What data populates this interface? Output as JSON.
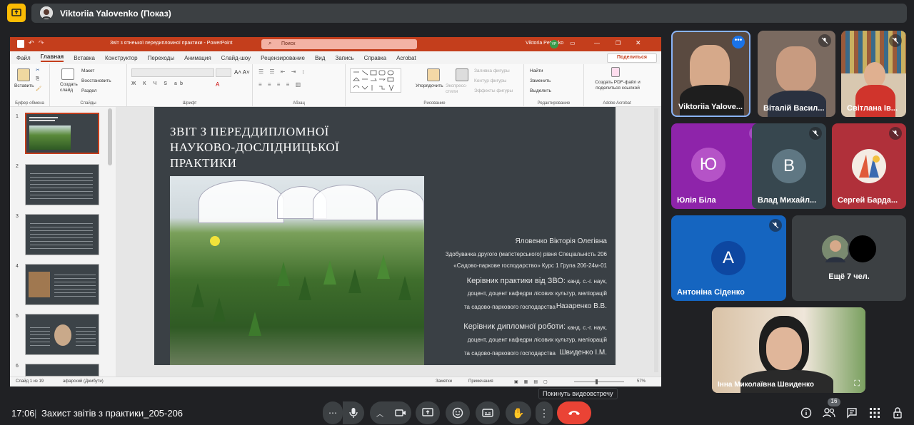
{
  "presenter": {
    "name": "Viktoriia Yalovenko (Показ)"
  },
  "ppt": {
    "window_title": "Звіт з ятнеької передипломної практики  -  PowerPoint",
    "search_placeholder": "Поиск",
    "user": "Viktoria Petrenko",
    "user_initials": "VP",
    "menu": [
      "Файл",
      "Главная",
      "Вставка",
      "Конструктор",
      "Переходы",
      "Анимация",
      "Слайд-шоу",
      "Рецензирование",
      "Вид",
      "Запись",
      "Справка",
      "Acrobat"
    ],
    "share": "Поделиться",
    "ribbon": {
      "insert": "Вставить",
      "clipboard": "Буфер обмена",
      "create_slide": "Создать слайд",
      "layout": "Макет",
      "reset": "Восстановить",
      "section": "Раздел",
      "slides": "Слайды",
      "font": "Шрифт",
      "paragraph": "Абзац",
      "arrange": "Упорядочить",
      "express_styles": "Экспресс-стили",
      "shape_fill": "Заливка фигуры",
      "shape_outline": "Контур фигуры",
      "shape_effects": "Эффекты фигуры",
      "drawing": "Рисование",
      "find": "Найти",
      "replace": "Заменить",
      "select": "Выделить",
      "editing": "Редактирование",
      "create_pdf": "Создать PDF-файл и поделиться ссылкой",
      "adobe": "Adobe Acrobat"
    },
    "slide_numbers": [
      "1",
      "2",
      "3",
      "4",
      "5",
      "6"
    ],
    "status": {
      "slide": "Слайд 1 из 19",
      "lang": "афарский (Джибути)",
      "notes": "Заметки",
      "comments": "Примечания",
      "zoom": "57%"
    }
  },
  "slide": {
    "title_lines": [
      "ЗВІТ З ПЕРЕДДИПЛОМНОЇ",
      "НАУКОВО-ДОСЛІДНИЦЬКОЇ",
      "ПРАКТИКИ"
    ],
    "author": "Яловенко Вікторія Олегівна",
    "degree1": "Здобувачка другого (магістерського) рівня Спеціальність  206",
    "degree2": "«Садово-паркове господарство»  Курс 1 Група 206-24м-01",
    "head_zvo": "Керівник практики від ЗВО:",
    "head_zvo_title": "канд. с.-г. наук,",
    "head_zvo_line2": "доцент, доцент кафедри лісових культур, меліорацій",
    "head_zvo_line3": "та садово-паркового господарства",
    "head_zvo_name": "Назаренко В.В.",
    "head_dipl": "Керівник дипломної роботи:",
    "head_dipl_title": "канд. с.-г. наук,",
    "head_dipl_line2": "доцент, доцент кафедри лісових культур, меліорацій",
    "head_dipl_line3": "та садово-паркового господарства",
    "head_dipl_name": "Швиденко І.М."
  },
  "participants": [
    {
      "name": "Viktoriia Yalove...",
      "color": "#5a4a40"
    },
    {
      "name": "Віталій Васил...",
      "color": "#7a6a60"
    },
    {
      "name": "Світлана Ів...",
      "color": "#8a7060"
    },
    {
      "name": "Юлія Біла",
      "initial": "Ю",
      "color": "#8e24aa",
      "avatar": "#b553c7"
    },
    {
      "name": "Влад Михайл...",
      "initial": "В",
      "color": "#37474f",
      "avatar": "#5f7783"
    },
    {
      "name": "Сергей Барда...",
      "color": "#b0303a"
    },
    {
      "name": "Антоніна Сіденко",
      "initial": "А",
      "color": "#1565c0",
      "avatar": "#0d47a1"
    },
    {
      "name": "Ещё 7 чел."
    },
    {
      "name": "Інна Миколаївна Швиденко",
      "color": "#c9a98a"
    }
  ],
  "bottom": {
    "time": "17:06",
    "separator": "|",
    "meeting": "Захист звітів з практики_205-206",
    "tooltip": "Покинуть видеовстречу",
    "people_count": "16"
  }
}
